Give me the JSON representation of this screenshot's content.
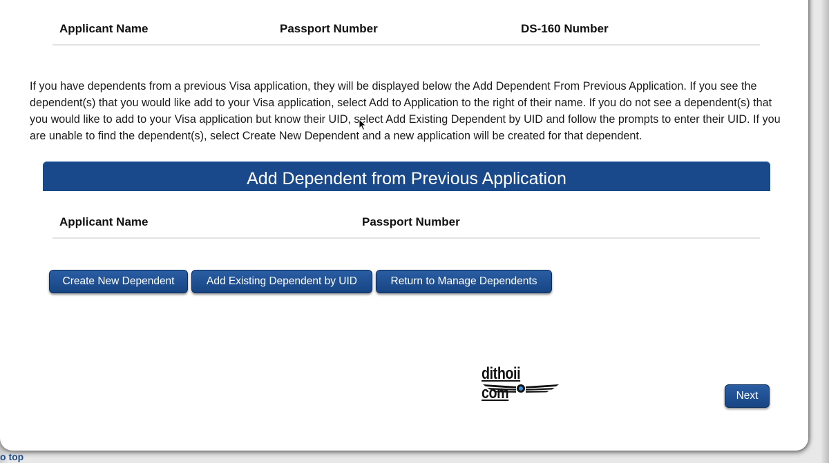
{
  "top_table": {
    "headers": [
      "Applicant Name",
      "Passport Number",
      "DS-160 Number"
    ]
  },
  "intro_text": "If you have dependents from a previous Visa application, they will be displayed below the Add Dependent From Previous Application. If you see the dependent(s) that you would like add to your Visa application, select Add to Application to the right of their name. If you do not see a dependent(s) that you would like to add to your Visa application but know their UID, select Add Existing Dependent by UID and follow the prompts to enter their UID. If you are unable to find the dependent(s), select Create New Dependent and a new application will be created for that dependent.",
  "section": {
    "title": "Add Dependent from Previous Application",
    "headers": [
      "Applicant Name",
      "Passport Number"
    ]
  },
  "buttons": {
    "create_new": "Create New Dependent",
    "add_existing": "Add Existing Dependent by UID",
    "return_manage": "Return to Manage Dependents",
    "next": "Next"
  },
  "watermark": {
    "text": "dithoii com"
  },
  "footer": {
    "back_to_top": "o top"
  },
  "colors": {
    "brand_blue": "#19498a",
    "button_blue": "#174584"
  }
}
